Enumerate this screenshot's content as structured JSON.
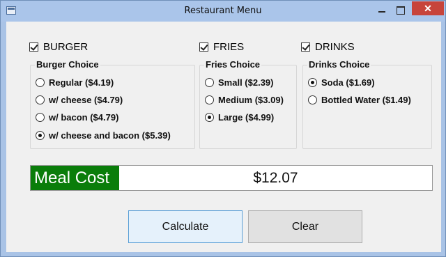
{
  "window": {
    "title": "Restaurant Menu",
    "close_glyph": "✕"
  },
  "categories": {
    "burger": {
      "label": "BURGER",
      "checked": true
    },
    "fries": {
      "label": "FRIES",
      "checked": true
    },
    "drinks": {
      "label": "DRINKS",
      "checked": true
    }
  },
  "burger_group": {
    "title": "Burger Choice",
    "options": [
      {
        "label": "Regular ($4.19)",
        "selected": false
      },
      {
        "label": "w/ cheese ($4.79)",
        "selected": false
      },
      {
        "label": "w/ bacon ($4.79)",
        "selected": false
      },
      {
        "label": "w/ cheese and bacon ($5.39)",
        "selected": true
      }
    ]
  },
  "fries_group": {
    "title": "Fries Choice",
    "options": [
      {
        "label": "Small ($2.39)",
        "selected": false
      },
      {
        "label": "Medium ($3.09)",
        "selected": false
      },
      {
        "label": "Large ($4.99)",
        "selected": true
      }
    ]
  },
  "drinks_group": {
    "title": "Drinks Choice",
    "options": [
      {
        "label": "Soda ($1.69)",
        "selected": true
      },
      {
        "label": "Bottled Water ($1.49)",
        "selected": false
      }
    ]
  },
  "meal": {
    "label": "Meal Cost",
    "value": "$12.07",
    "label_bg": "#0a7d0a"
  },
  "buttons": {
    "calculate": "Calculate",
    "clear": "Clear"
  }
}
